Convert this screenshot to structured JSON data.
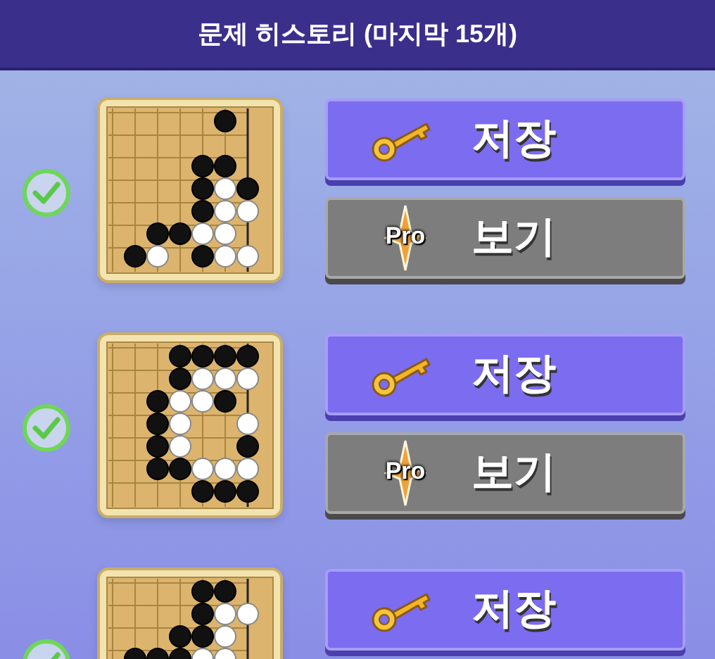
{
  "header": {
    "title": "문제 히스토리 (마지막 15개)"
  },
  "items": [
    {
      "checked": true,
      "board": {
        "kind": "picture"
      },
      "buttons": [
        {
          "kind": "save",
          "label": "저장"
        },
        {
          "kind": "pro",
          "label": "보기",
          "badge": "Pro"
        }
      ]
    },
    {
      "checked": true,
      "board": {
        "kind": "picture"
      },
      "buttons": [
        {
          "kind": "save",
          "label": "저장"
        },
        {
          "kind": "pro",
          "label": "보기",
          "badge": "Pro"
        }
      ]
    },
    {
      "checked": true,
      "board": {
        "kind": "picture"
      },
      "buttons": [
        {
          "kind": "save",
          "label": "저장"
        }
      ]
    }
  ]
}
